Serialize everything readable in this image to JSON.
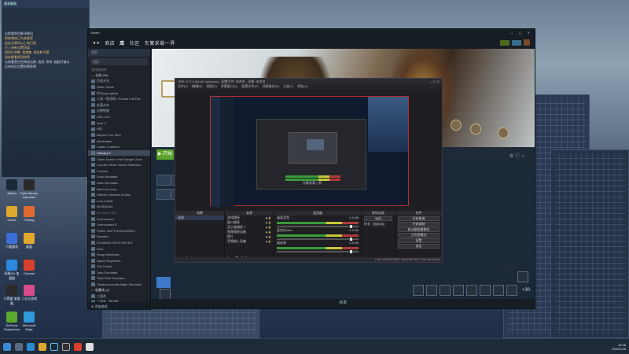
{
  "desktop": {
    "sticky_header": "随意截图",
    "sticky_lines": [
      {
        "text": "以前看到白影诗我问",
        "color": "w"
      },
      {
        "text": "把新增加已为老推荐",
        "color": "o"
      },
      {
        "text": "这这点暂时以上有已经",
        "color": "o"
      },
      {
        "text": "已上海有设置场暂",
        "color": "o"
      },
      {
        "text": "把时后将教, 把就教, 把会和不管",
        "color": "o"
      },
      {
        "text": "追处都看到问你是",
        "color": "o"
      },
      {
        "text": "以前看到白色网站出来, 选用, 所有, 抽起开放以",
        "color": "w"
      },
      {
        "text": "后有时后设置好教家吧",
        "color": "w"
      }
    ],
    "icons": [
      {
        "label": "Steam",
        "name": "steam-desktop-icon",
        "color": "#1b2838"
      },
      {
        "label": "Epic Games Launcher",
        "name": "epic-desktop-icon",
        "color": "#2a2a2a"
      },
      {
        "label": "Game",
        "name": "game-folder-icon",
        "color": "#e0a82e"
      },
      {
        "label": "Fishing",
        "name": "fishing-desktop-icon",
        "color": "#e06a2e"
      },
      {
        "label": "小盒盒攻",
        "name": "app-desktop-icon",
        "color": "#3b6fd8"
      },
      {
        "label": "桌面",
        "name": "folder-desktop-icon",
        "color": "#e0a82e"
      },
      {
        "label": "网易UU 加速器",
        "name": "uu-desktop-icon",
        "color": "#2e8ae0"
      },
      {
        "label": "Chrome",
        "name": "chrome-desktop-icon",
        "color": "#d8402e"
      },
      {
        "label": "小黑盒 加速器",
        "name": "xhh-desktop-icon",
        "color": "#2b2b2b"
      },
      {
        "label": "二次元游戏",
        "name": "acg-desktop-icon",
        "color": "#d84a8a"
      },
      {
        "label": "GeForce Experience",
        "name": "nvidia-desktop-icon",
        "color": "#5aa82e"
      },
      {
        "label": "Microsoft Edge",
        "name": "edge-desktop-icon",
        "color": "#2e9ad8"
      }
    ]
  },
  "steam": {
    "title": "Steam",
    "nav": [
      "商店",
      "库",
      "社区",
      "东篱采菊一界"
    ],
    "home": "主页",
    "search_placeholder": "搜索",
    "group_label": "游戏和软件",
    "section_all": "— 全部 (84)",
    "games": [
      {
        "label": "百战天虫",
        "sel": false,
        "dim": false
      },
      {
        "label": "Warm Snow",
        "sel": false,
        "dim": false
      },
      {
        "label": "的Sheyongkuai",
        "sel": false,
        "dim": false
      },
      {
        "label": "人类一败涂地 / Human Fall Flat",
        "sel": false,
        "dim": false
      },
      {
        "label": "失落方舟",
        "sel": false,
        "dim": false
      },
      {
        "label": "幻兽帕鲁",
        "sel": false,
        "dim": false
      },
      {
        "label": "ARK OUT",
        "sel": false,
        "dim": false
      },
      {
        "label": "Ame 3",
        "sel": false,
        "dim": false
      },
      {
        "label": "B站",
        "sel": false,
        "dim": false
      },
      {
        "label": "Beyond The Wire",
        "sel": false,
        "dim": false
      },
      {
        "label": "Blacksalter",
        "sel": false,
        "dim": false
      },
      {
        "label": "Castle Crashers",
        "sel": false,
        "dim": false
      },
      {
        "label": "Chivalry 2",
        "sel": true,
        "dim": false
      },
      {
        "label": "Clone Drone in the Danger Zone",
        "sel": false,
        "dim": false
      },
      {
        "label": "Counter-Strike Global Offensive",
        "sel": false,
        "dim": false
      },
      {
        "label": "Foxhole",
        "sel": false,
        "dim": false
      },
      {
        "label": "Goat Simulator",
        "sel": false,
        "dim": false
      },
      {
        "label": "Hand Simulator",
        "sel": false,
        "dim": false
      },
      {
        "label": "Hell Let Loose",
        "sel": false,
        "dim": false
      },
      {
        "label": "HellNet: Helmets At War",
        "sel": false,
        "dim": false
      },
      {
        "label": "Lock Castle",
        "sel": false,
        "dim": false
      },
      {
        "label": "MORDHAU",
        "sel": false,
        "dim": false
      },
      {
        "label": "No Man's Sky",
        "sel": false,
        "dim": true
      },
      {
        "label": "Overcooked",
        "sel": false,
        "dim": false
      },
      {
        "label": "Overcooked! 2",
        "sel": false,
        "dim": false
      },
      {
        "label": "PUBG: BATTLEGROUNDS",
        "sel": false,
        "dim": false
      },
      {
        "label": "Raceflict",
        "sel": false,
        "dim": false
      },
      {
        "label": "RUNNING WITH RIFLES",
        "sel": false,
        "dim": false
      },
      {
        "label": "Rust",
        "sel": false,
        "dim": false
      },
      {
        "label": "Scrap Mechanic",
        "sel": false,
        "dim": false
      },
      {
        "label": "Space Engineers",
        "sel": false,
        "dim": false
      },
      {
        "label": "The Forest",
        "sel": false,
        "dim": false
      },
      {
        "label": "Tank Simulator",
        "sel": false,
        "dim": false
      },
      {
        "label": "Total Tank Simulator",
        "sel": false,
        "dim": false
      },
      {
        "label": "Totally Accurate Battle Simulator",
        "sel": false,
        "dim": false
      }
    ],
    "section_fav": "— 收藏夹 (2)",
    "fav": [
      {
        "label": "三国杀",
        "sel": false,
        "dim": false
      },
      {
        "label": "三国杀 - 移动版",
        "sel": false,
        "dim": false
      }
    ],
    "add_game": "添加游戏",
    "play": "开始",
    "friends": "好友",
    "more_ach": "+30"
  },
  "obs": {
    "title": "OBS 27.2.4 (64-bit, windows) - 配置文件: 未命名 - 场景: 未命名",
    "menus": [
      "文件(F)",
      "编辑(E)",
      "视图(V)",
      "停靠窗口(D)",
      "配置文件(P)",
      "场景集合(S)",
      "工具(T)",
      "帮助(H)"
    ],
    "preview_label": "东篱采菊一界",
    "dock_scenes": "场景",
    "dock_sources": "来源",
    "dock_mixer": "混音器",
    "dock_transitions": "转场动画",
    "dock_controls": "控件",
    "scenes": [
      "场景"
    ],
    "sources": [
      "游戏捕获",
      "窗口捕获",
      "显示器捕获 2",
      "视频捕获设备",
      "图片",
      "音频输入采集"
    ],
    "mixer": [
      {
        "label": "桌面音频",
        "db": "0.0 dB"
      },
      {
        "label": "麦克风/Aux",
        "db": "0.0 dB"
      },
      {
        "label": "媒体源",
        "db": "0.0 dB"
      }
    ],
    "transition": "淡出",
    "duration_label": "时长",
    "duration": "300 ms",
    "controls": [
      "开始推流",
      "开始录制",
      "启动虚拟摄像机",
      "工作室模式",
      "设置",
      "退出"
    ],
    "status": "LIVE: 00:00:00  REC: 00:00:00  CPU: 1.3%, 60.00 fps"
  },
  "taskbar": {
    "time": "16:36",
    "date": "2022/4/26"
  }
}
